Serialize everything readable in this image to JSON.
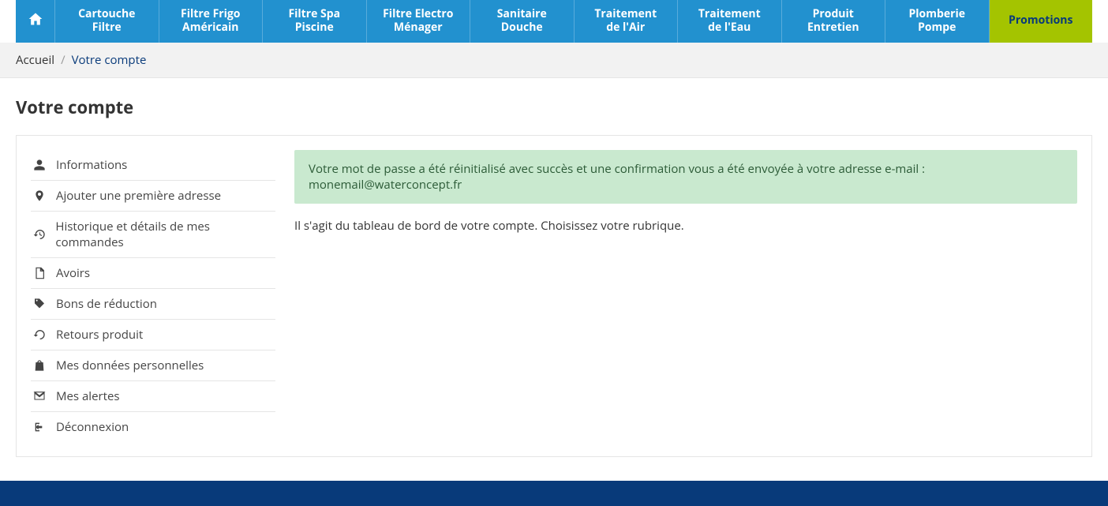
{
  "nav": {
    "items": [
      {
        "label": "Cartouche\nFiltre"
      },
      {
        "label": "Filtre Frigo\nAméricain"
      },
      {
        "label": "Filtre Spa\nPiscine"
      },
      {
        "label": "Filtre Electro\nMénager"
      },
      {
        "label": "Sanitaire\nDouche"
      },
      {
        "label": "Traitement\nde l'Air"
      },
      {
        "label": "Traitement\nde l'Eau"
      },
      {
        "label": "Produit\nEntretien"
      },
      {
        "label": "Plomberie\nPompe"
      },
      {
        "label": "Promotions"
      }
    ]
  },
  "breadcrumb": {
    "home": "Accueil",
    "sep": "/",
    "current": "Votre compte"
  },
  "page_title": "Votre compte",
  "sidebar": {
    "items": [
      {
        "label": "Informations"
      },
      {
        "label": "Ajouter une première adresse"
      },
      {
        "label": "Historique et détails de mes commandes"
      },
      {
        "label": "Avoirs"
      },
      {
        "label": "Bons de réduction"
      },
      {
        "label": "Retours produit"
      },
      {
        "label": "Mes données personnelles"
      },
      {
        "label": "Mes alertes"
      },
      {
        "label": "Déconnexion"
      }
    ]
  },
  "alert": "Votre mot de passe a été réinitialisé avec succès et une confirmation vous a été envoyée à votre adresse e-mail : monemail@waterconcept.fr",
  "dashboard_text": "Il s'agit du tableau de bord de votre compte. Choisissez votre rubrique."
}
